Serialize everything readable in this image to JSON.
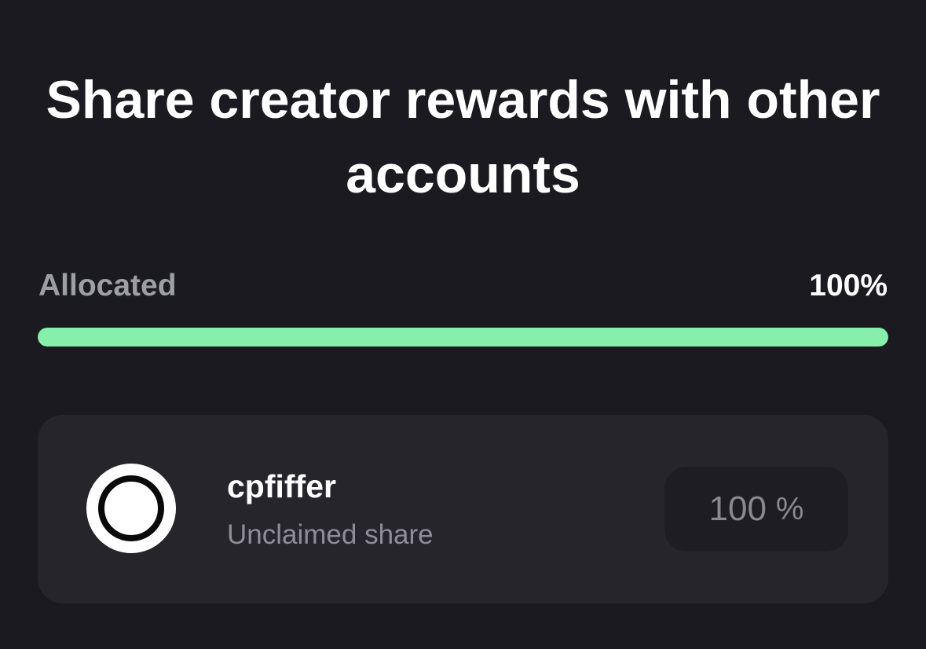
{
  "header": {
    "title": "Share creator rewards with other accounts"
  },
  "allocation": {
    "label": "Allocated",
    "value_text": "100%",
    "progress_percent": 100,
    "bar_color": "#86efac"
  },
  "recipients": [
    {
      "username": "cpfiffer",
      "status": "Unclaimed share",
      "share_value": "100",
      "share_unit": "%",
      "avatar_icon": "circle-avatar-icon"
    }
  ]
}
